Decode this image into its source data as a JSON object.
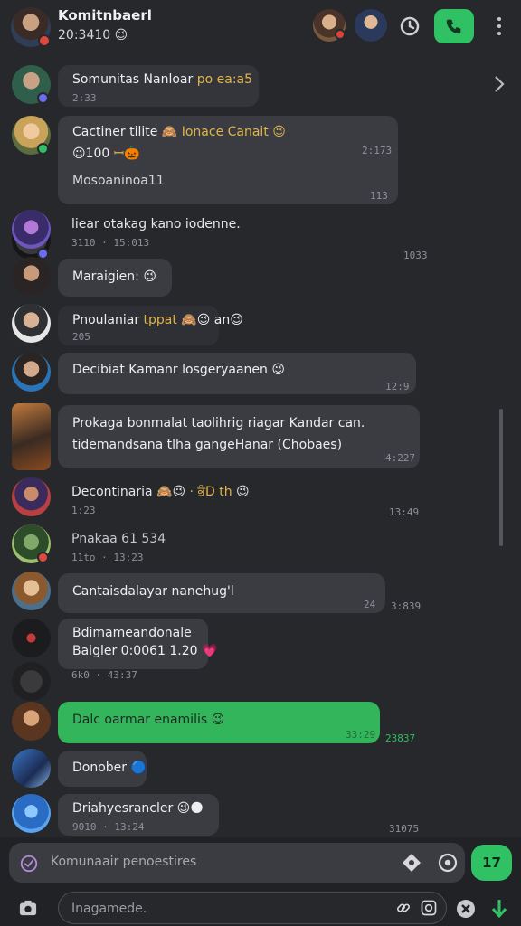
{
  "header": {
    "title": "Komitnbaerl",
    "subtitle": "20:3410 😉"
  },
  "pinned": {
    "text_main": "Somunitas Nanloar",
    "text_accent": "po ea:a5",
    "meta": "2:33"
  },
  "messages": [
    {
      "line1_a": "Cactiner tilite 🙈",
      "line1_b": "Ionace Canait 😉",
      "line2": "😉100",
      "line2_b": "ꟷ🎃",
      "time": "2:173"
    },
    {
      "line1": "Mosoaninoa11",
      "time": "113",
      "time2": "1033"
    },
    {
      "line1": "liear otakag kano iodenne.",
      "time": "3110 · 15:013"
    },
    {
      "line1": "Maraigien: 😉"
    },
    {
      "line1_a": "Pnoulaniar",
      "line1_b": "tppat",
      "line1_c": "🙈😉 an😉",
      "time": "205"
    },
    {
      "line1": "Decibiat Kamanr losgeryaanen 😉",
      "time": "12:9"
    },
    {
      "line1": "Prokaga bonmalat taolihrig riagar Kandar can.",
      "line2": "tidemandsana tlha gangeHanar (Chobaes)",
      "time": "4:227"
    },
    {
      "line1_a": "Decontinaria 🙈😉",
      "line1_b": "· ਭੰD th",
      "line1_c": "😉",
      "time": "1:23",
      "time2": "13:49"
    },
    {
      "line1": "Pnakaa 61 534",
      "time": "11to · 13:23"
    },
    {
      "line1": "Cantaisdalayar nanehug'l",
      "time": "24",
      "time2": "3:839"
    },
    {
      "line1": "Bdimameandonale",
      "line2": "Baigler 0:0061 1.20 💗",
      "time": "6k0 · 43:37"
    },
    {
      "line1": "Dalc oarmar enamilis 😉",
      "time": "33:29",
      "time2": "23837"
    },
    {
      "line1": "Donober 🔵"
    },
    {
      "line1": "Driahyesrancler 😉🌑",
      "time": "9010 · 13:24",
      "time2": "31075"
    }
  ],
  "composer": {
    "placeholder": "Komunaair penoestires",
    "send_label": "17",
    "secondary_placeholder": "Inagamede."
  }
}
